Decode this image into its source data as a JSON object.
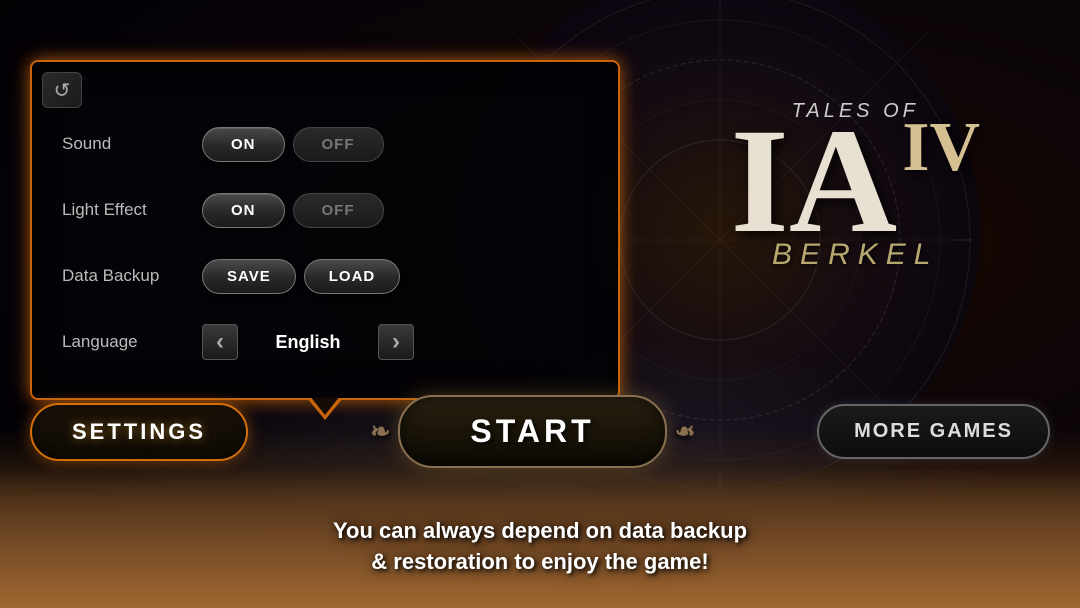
{
  "background": {
    "color": "#000000"
  },
  "settings_panel": {
    "back_button_icon": "↺",
    "rows": [
      {
        "label": "Sound",
        "type": "toggle",
        "on_label": "ON",
        "off_label": "OFF",
        "active": "on"
      },
      {
        "label": "Light Effect",
        "type": "toggle",
        "on_label": "ON",
        "off_label": "OFF",
        "active": "on"
      },
      {
        "label": "Data Backup",
        "type": "actions",
        "save_label": "SAVE",
        "load_label": "LOAD"
      },
      {
        "label": "Language",
        "type": "language",
        "value": "English",
        "left_arrow": "‹",
        "right_arrow": "›"
      }
    ]
  },
  "nav": {
    "settings_label": "SETTINGS",
    "start_label": "START",
    "more_games_label": "MORE GAMES"
  },
  "bottom_message": {
    "line1": "You can always depend on data backup",
    "line2": "& restoration to enjoy the game!"
  },
  "logo": {
    "subtitle": "TALES OF",
    "main": "IA",
    "roman": "IV",
    "berkel": "BERKEL"
  }
}
